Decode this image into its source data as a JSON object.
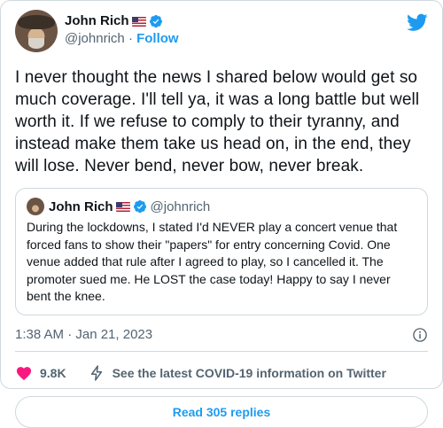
{
  "author": {
    "name": "John Rich",
    "handle": "@johnrich",
    "follow_label": "Follow",
    "separator": "·"
  },
  "tweet": {
    "text": "I never thought the news I shared below would get so much coverage. I'll tell ya, it was a long battle but well worth it. If we refuse to comply to their tyranny, and instead make them take us head on, in the end, they will lose. Never bend, never bow, never break."
  },
  "quote": {
    "name": "John Rich",
    "handle": "@johnrich",
    "text": "During the lockdowns, I stated I'd NEVER play a concert venue that forced fans to show their \"papers\" for entry concerning Covid. One venue added that rule after I agreed to play, so I cancelled it. The promoter sued me. He LOST the case today! Happy to say I never bent the knee."
  },
  "meta": {
    "timestamp": "1:38 AM · Jan 21, 2023"
  },
  "actions": {
    "likes": "9.8K",
    "covid_info": "See the latest COVID-19 information on Twitter"
  },
  "footer": {
    "read_replies": "Read 305 replies"
  },
  "colors": {
    "accent": "#1d9bf0",
    "heart": "#f91880",
    "secondary_text": "#536471",
    "border": "#cfd9de"
  },
  "icons": [
    "verified-badge-icon",
    "twitter-bird-icon",
    "info-icon",
    "heart-icon",
    "bolt-icon"
  ]
}
